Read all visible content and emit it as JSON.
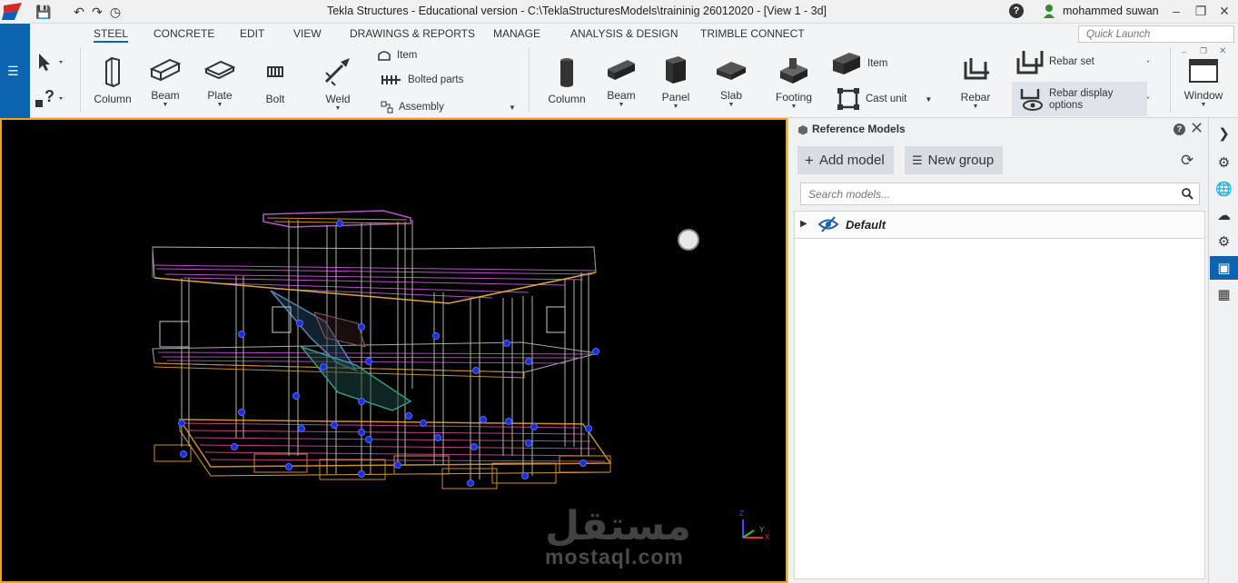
{
  "titlebar": {
    "title": "Tekla Structures - Educational version - C:\\TeklaStructuresModels\\traininig 26012020  - [View 1 - 3d]",
    "user": "mohammed suwan",
    "help": "?"
  },
  "tabs": [
    "STEEL",
    "CONCRETE",
    "EDIT",
    "VIEW",
    "DRAWINGS & REPORTS",
    "MANAGE",
    "ANALYSIS & DESIGN",
    "TRIMBLE CONNECT"
  ],
  "quick_launch_placeholder": "Quick Launch",
  "steel_tools": {
    "column": "Column",
    "beam": "Beam",
    "plate": "Plate",
    "bolt": "Bolt",
    "weld": "Weld",
    "item": "Item",
    "bolted_parts": "Bolted parts",
    "assembly": "Assembly"
  },
  "concrete_tools": {
    "column": "Column",
    "beam": "Beam",
    "panel": "Panel",
    "slab": "Slab",
    "footing": "Footing",
    "item": "Item",
    "cast_unit": "Cast unit",
    "rebar": "Rebar",
    "rebar_set": "Rebar set",
    "rebar_display_options": "Rebar display options"
  },
  "window_tool": "Window",
  "watermark": {
    "arabic": "مستقل",
    "latin": "mostaql.com"
  },
  "panel": {
    "title": "Reference Models",
    "help": "?",
    "add_model": "Add model",
    "new_group": "New group",
    "search_placeholder": "Search models...",
    "groups": [
      {
        "name": "Default"
      }
    ]
  },
  "colors": {
    "accent": "#0c63b0",
    "viewport_border": "#f3a21c",
    "viewport_bg": "#000000"
  }
}
